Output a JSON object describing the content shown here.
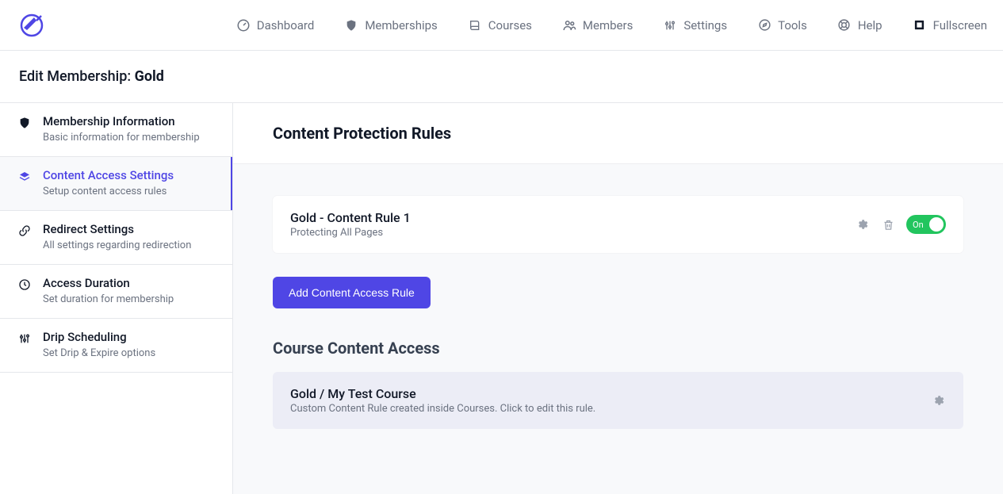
{
  "nav": {
    "dashboard": "Dashboard",
    "memberships": "Memberships",
    "courses": "Courses",
    "members": "Members",
    "settings": "Settings",
    "tools": "Tools",
    "help": "Help",
    "fullscreen": "Fullscreen"
  },
  "page": {
    "title_prefix": "Edit Membership: ",
    "title_name": "Gold"
  },
  "sidebar": [
    {
      "title": "Membership Information",
      "sub": "Basic information for membership"
    },
    {
      "title": "Content Access Settings",
      "sub": "Setup content access rules"
    },
    {
      "title": "Redirect Settings",
      "sub": "All settings regarding redirection"
    },
    {
      "title": "Access Duration",
      "sub": "Set duration for membership"
    },
    {
      "title": "Drip Scheduling",
      "sub": "Set Drip & Expire options"
    }
  ],
  "content": {
    "section_title": "Content Protection Rules",
    "rule": {
      "title": "Gold - Content Rule 1",
      "sub": "Protecting All Pages",
      "toggle_label": "On"
    },
    "add_button": "Add Content Access Rule",
    "course_section_title": "Course Content Access",
    "course": {
      "title": "Gold / My Test Course",
      "sub": "Custom Content Rule created inside Courses. Click to edit this rule."
    }
  }
}
